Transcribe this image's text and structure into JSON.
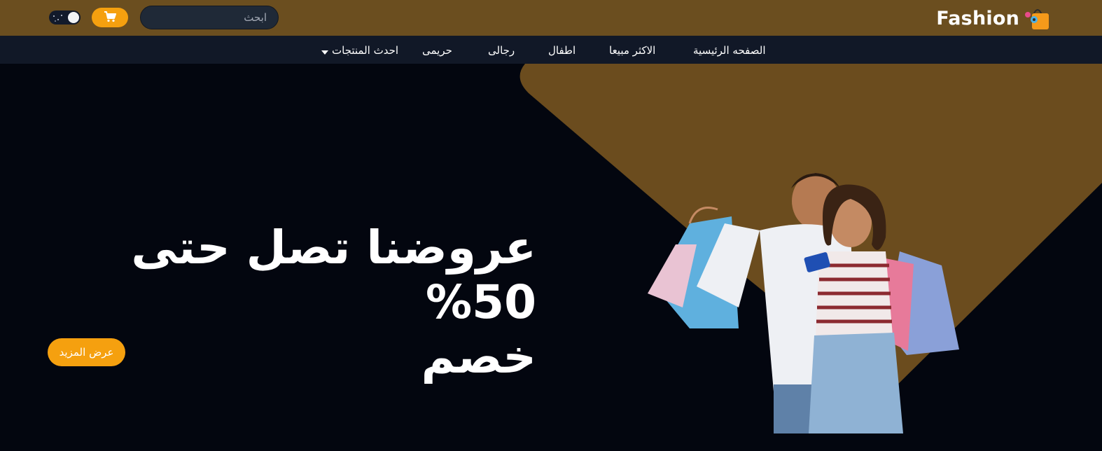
{
  "header": {
    "brand": "Fashion",
    "search": {
      "placeholder": "ابحث",
      "value": ""
    },
    "icons": {
      "cart": "cart-icon",
      "theme_toggle": "theme-toggle-icon",
      "logo": "shopping-bag-icon"
    },
    "colors": {
      "bar": "#6b4e1f",
      "accent": "#f5a00f",
      "nav": "#111827"
    }
  },
  "nav": {
    "items": [
      {
        "label": "الصفحه الرئيسية"
      },
      {
        "label": "الاكثر مبيعا"
      },
      {
        "label": "اطفال"
      },
      {
        "label": "رجالى"
      },
      {
        "label": "حريمى"
      },
      {
        "label": "احدث المنتجات"
      }
    ]
  },
  "hero": {
    "headline_line1": "عروضنا تصل حتى 50%",
    "headline_line2": "خصم",
    "cta": "عرض المزيد"
  }
}
